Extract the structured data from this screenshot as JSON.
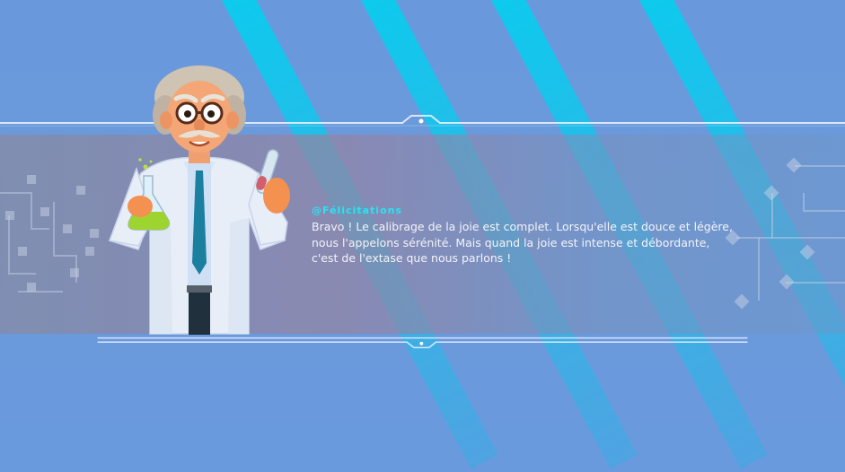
{
  "dialog": {
    "speaker": "@Félicitations",
    "message": "Bravo ! Le calibrage de la joie est complet. Lorsqu'elle est douce et légère, nous l'appelons sérénité. Mais quand la joie est intense et débordante, c'est de l'extase que nous parlons !"
  },
  "character": {
    "name": "scientist"
  },
  "colors": {
    "background": "#6a98dc",
    "accent_stripe": "#00d2f0",
    "speaker_text": "#28e4f4",
    "message_text": "#f4f4f8"
  }
}
